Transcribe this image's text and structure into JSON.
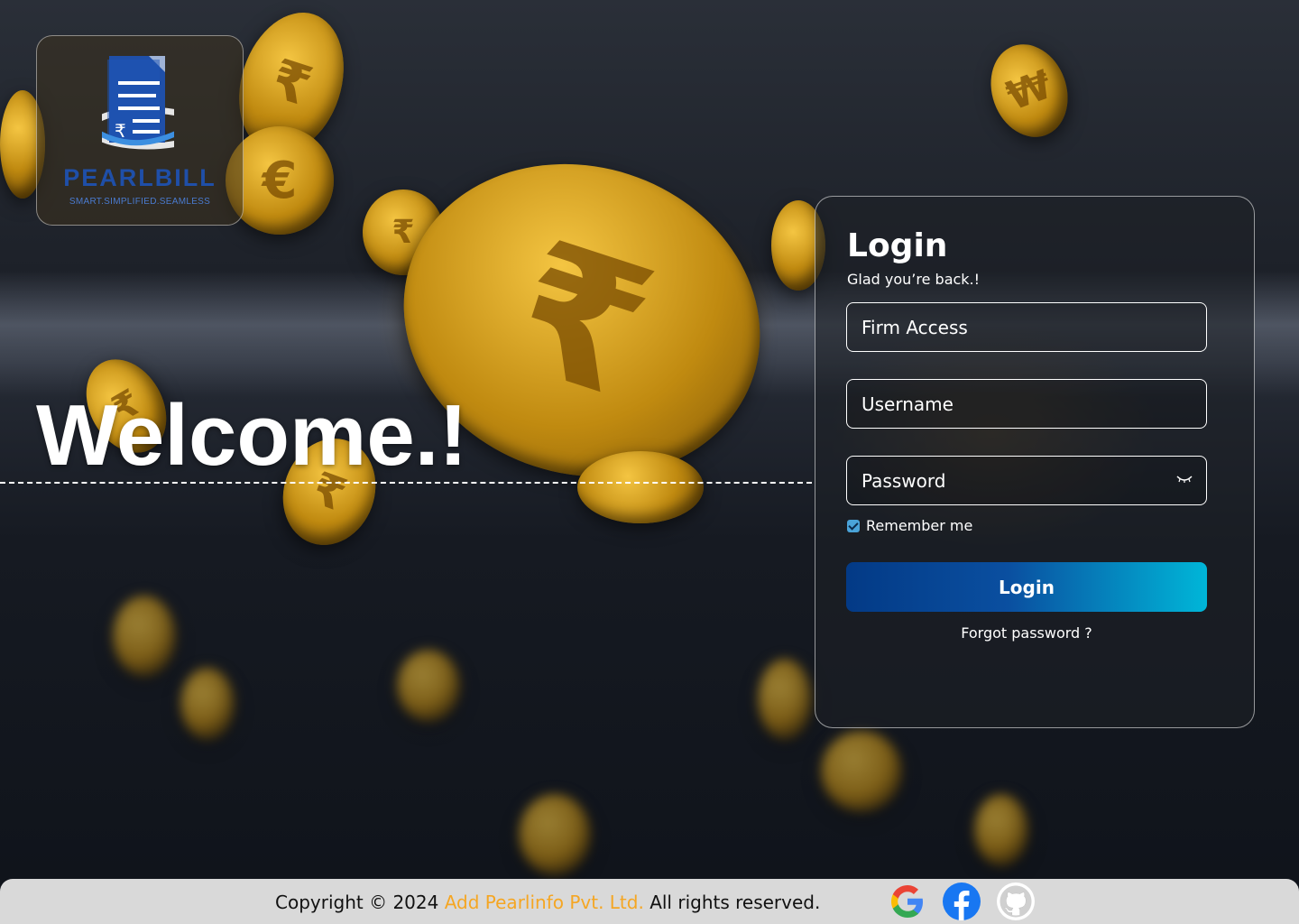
{
  "brand": {
    "name": "PEARLBILL",
    "tagline": "SMART.SIMPLIFIED.SEAMLESS"
  },
  "hero": {
    "welcome": "Welcome.!"
  },
  "login": {
    "title": "Login",
    "subtitle": "Glad you’re back.!",
    "firm_placeholder": "Firm Access",
    "username_placeholder": "Username",
    "password_placeholder": "Password",
    "remember_label": "Remember me",
    "remember_checked": true,
    "button_label": "Login",
    "forgot_label": "Forgot password ?"
  },
  "footer": {
    "copyright_prefix": "Copyright © 2024",
    "company": "Add Pearlinfo Pvt. Ltd.",
    "rights": "All rights reserved.",
    "social_icons": [
      "google-icon",
      "facebook-icon",
      "github-icon"
    ]
  },
  "colors": {
    "accent_start": "#033a86",
    "accent_end": "#00b6d8",
    "company_link": "#f5a623",
    "footer_bg": "#d9d9d9"
  }
}
